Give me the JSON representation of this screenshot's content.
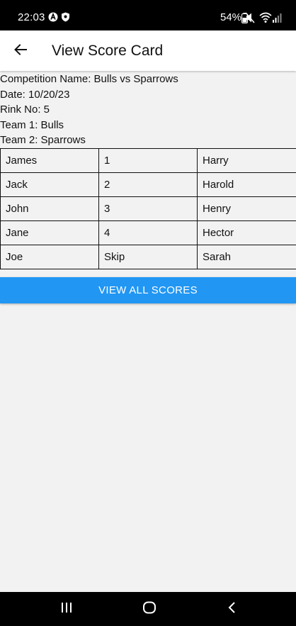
{
  "status_bar": {
    "time": "22:03",
    "battery": "54%",
    "icons": [
      "navigation-a-icon",
      "shield-icon",
      "mute-icon",
      "wifi-icon",
      "signal-icon",
      "battery-icon"
    ]
  },
  "app_bar": {
    "title": "View Score Card",
    "back_icon": "arrow-back-icon"
  },
  "details": {
    "competition": "Competition Name: Bulls vs Sparrows",
    "date": "Date: 10/20/23",
    "rink": "Rink No: 5",
    "team1": "Team 1: Bulls",
    "team2": "Team 2: Sparrows"
  },
  "score_table": {
    "rows": [
      [
        "James",
        "1",
        "Harry"
      ],
      [
        "Jack",
        "2",
        "Harold"
      ],
      [
        "John",
        "3",
        "Henry"
      ],
      [
        "Jane",
        "4",
        "Hector"
      ],
      [
        "Joe",
        "Skip",
        "Sarah"
      ]
    ]
  },
  "actions": {
    "view_all_label": "VIEW ALL SCORES"
  },
  "nav_bar": {
    "icons": [
      "recent-apps-icon",
      "home-icon",
      "back-icon"
    ]
  },
  "colors": {
    "accent": "#2196f3",
    "background": "#f2f2f2",
    "app_bar": "#ffffff",
    "system_bars": "#000000"
  }
}
